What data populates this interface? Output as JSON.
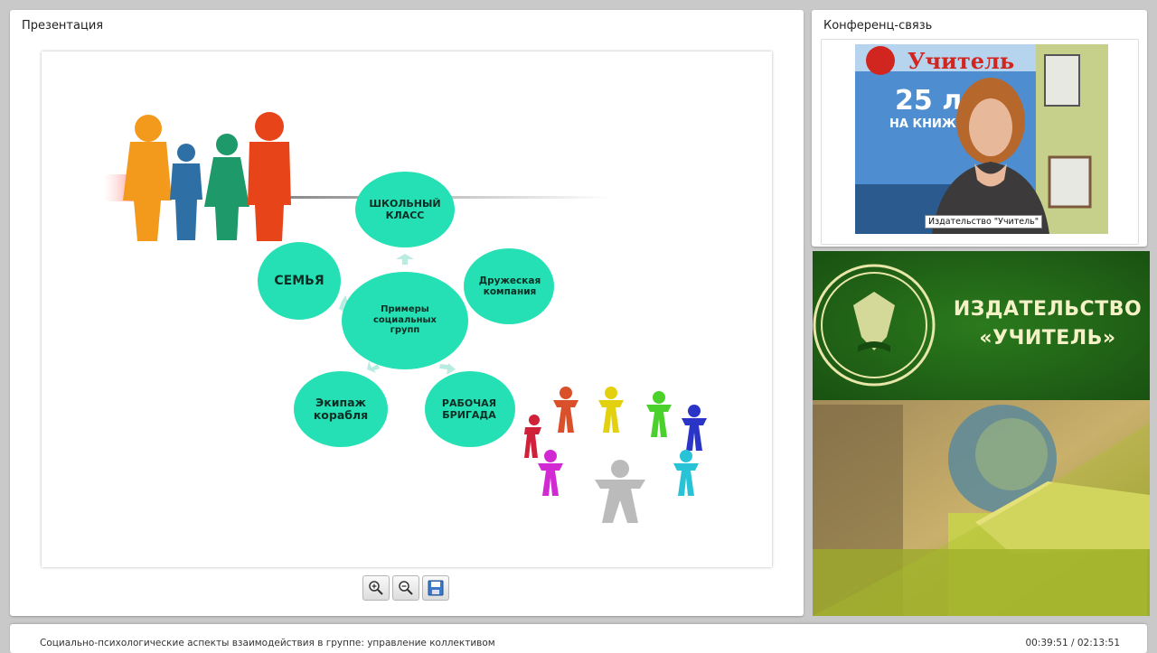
{
  "presentation": {
    "title": "Презентация",
    "slide": {
      "center": "Примеры социальных групп",
      "groups": [
        {
          "id": "school",
          "label": "ШКОЛЬНЫЙ КЛАСС"
        },
        {
          "id": "friends",
          "label": "Дружеская компания"
        },
        {
          "id": "work",
          "label": "РАБОЧАЯ БРИГАДА"
        },
        {
          "id": "crew",
          "label": "Экипаж корабля"
        },
        {
          "id": "family",
          "label": "СЕМЬЯ"
        }
      ],
      "circle_color": "#25e0b4"
    },
    "toolbar": {
      "zoom_in_icon": "zoom-in-icon",
      "zoom_out_icon": "zoom-out-icon",
      "save_icon": "save-icon"
    }
  },
  "conference": {
    "title": "Конференц-связь",
    "video_caption": "Издательство \"Учитель\"",
    "poster_text": "Учитель",
    "poster_years": "25 л",
    "poster_line": "НА КНИЖН"
  },
  "banner": {
    "line1": "ИЗДАТЕЛЬСТВО",
    "line2": "«УЧИТЕЛЬ»",
    "bg_color": "#1e5a14",
    "text_color": "#f5f2c8"
  },
  "footer": {
    "course_title": "Социально-психологические аспекты взаимодействия в группе: управление коллективом",
    "time": "00:39:51 / 02:13:51"
  }
}
